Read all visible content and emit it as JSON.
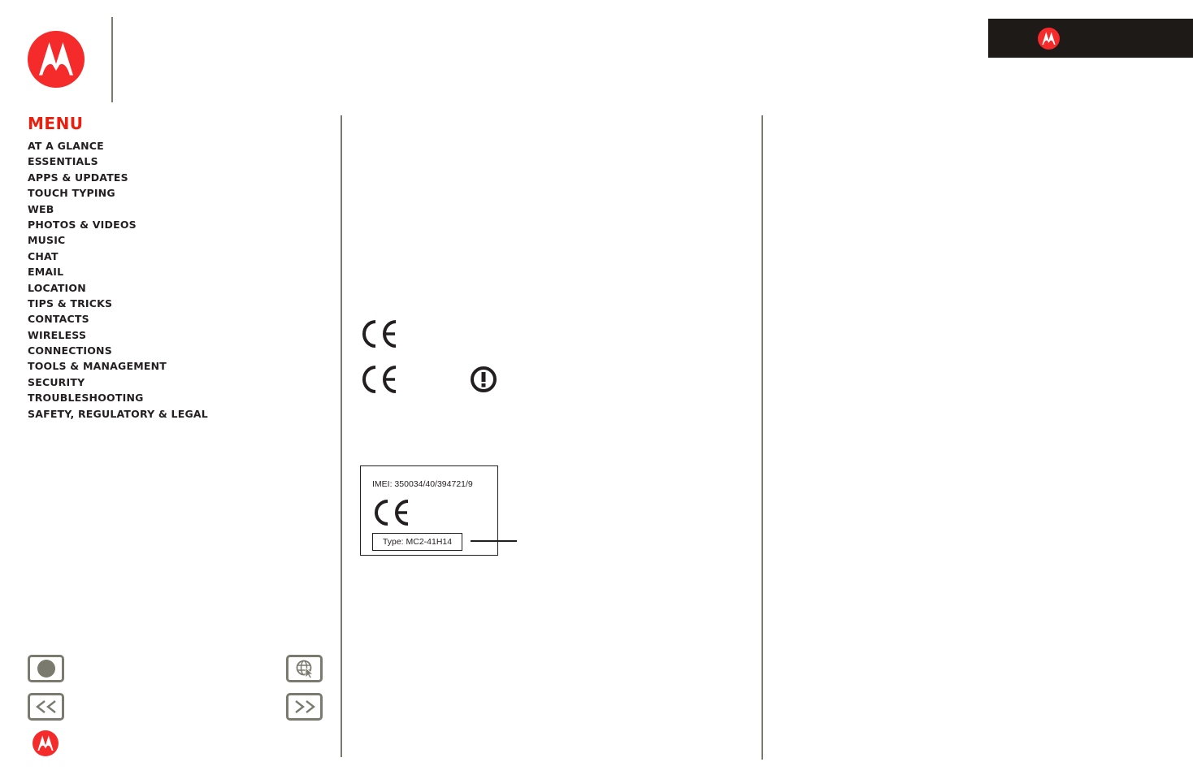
{
  "brand": {
    "name": "Motorola",
    "accent_color": "#e8200f",
    "logo_color": "#f52a2a",
    "banner_color": "#1e1a17",
    "ui_gray": "#7a7a6e"
  },
  "menu": {
    "title": "MENU",
    "items": [
      {
        "label": "AT A GLANCE"
      },
      {
        "label": "ESSENTIALS"
      },
      {
        "label": "APPS & UPDATES"
      },
      {
        "label": "TOUCH TYPING"
      },
      {
        "label": "WEB"
      },
      {
        "label": "PHOTOS & VIDEOS"
      },
      {
        "label": "MUSIC"
      },
      {
        "label": "CHAT"
      },
      {
        "label": "EMAIL"
      },
      {
        "label": "LOCATION"
      },
      {
        "label": "TIPS & TRICKS"
      },
      {
        "label": "CONTACTS"
      },
      {
        "label": "WIRELESS"
      },
      {
        "label": "CONNECTIONS"
      },
      {
        "label": "TOOLS & MANAGEMENT"
      },
      {
        "label": "SECURITY"
      },
      {
        "label": "TROUBLESHOOTING"
      },
      {
        "label": "SAFETY, REGULATORY & LEGAL"
      }
    ]
  },
  "nav_buttons": {
    "home": {
      "icon": "home-dot-icon"
    },
    "web": {
      "icon": "globe-cursor-icon"
    },
    "back": {
      "icon": "back-double-chevron-icon"
    },
    "next": {
      "icon": "next-double-chevron-icon"
    }
  },
  "content": {
    "marks": [
      {
        "icon": "ce-mark-icon"
      },
      {
        "icon": "ce-mark-icon",
        "alert_icon": "exclamation-circle-icon"
      }
    ],
    "product_label": {
      "imei": "IMEI: 350034/40/394721/9",
      "type": "Type: MC2-41H14"
    }
  }
}
